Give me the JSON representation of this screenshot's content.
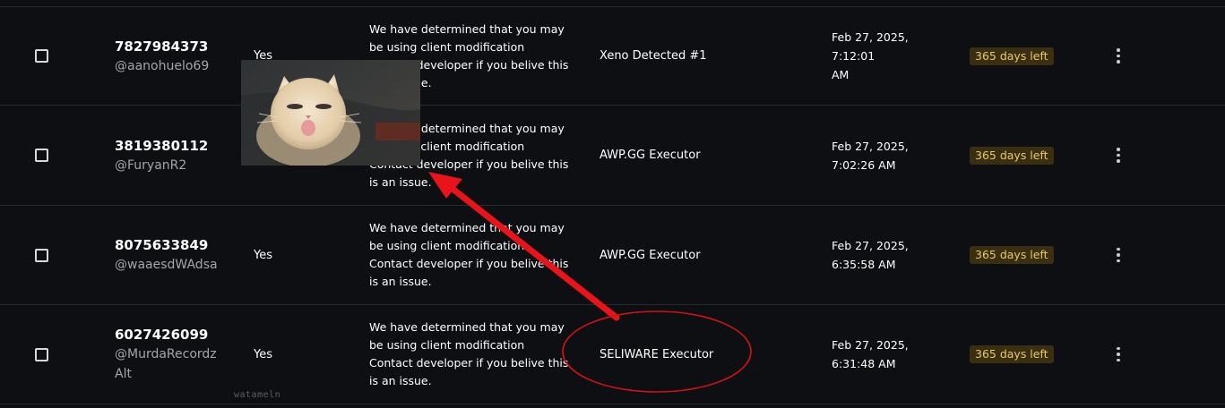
{
  "rows": [
    {
      "user_id": "7827984373",
      "handle": "@aanohuelo69",
      "banned": "Yes",
      "reason_lines": [
        "We have determined that you may",
        "be using client modification",
        "Contact developer if you belive this",
        "is an issue."
      ],
      "detection": "Xeno Detected #1",
      "date_line1": "Feb 27, 2025, 7:12:01",
      "date_line2": "AM",
      "remaining": "365 days left"
    },
    {
      "user_id": "3819380112",
      "handle": "@FuryanR2",
      "banned": "",
      "reason_lines": [
        "We have determined that you may",
        "be using client modification",
        "Contact developer if you belive this",
        "is an issue."
      ],
      "detection": "AWP.GG Executor",
      "date_line1": "Feb 27, 2025,",
      "date_line2": "7:02:26 AM",
      "remaining": "365 days left"
    },
    {
      "user_id": "8075633849",
      "handle": "@waaesdWAdsa",
      "banned": "Yes",
      "reason_lines": [
        "We have determined that you may",
        "be using client modification",
        "Contact developer if you belive this",
        "is an issue."
      ],
      "detection": "AWP.GG Executor",
      "date_line1": "Feb 27, 2025,",
      "date_line2": "6:35:58 AM",
      "remaining": "365 days left"
    },
    {
      "user_id": "6027426099",
      "handle": "@MurdaRecordz Alt",
      "banned": "Yes",
      "reason_lines": [
        "We have determined that you may",
        "be using client modification",
        "Contact developer if you belive this",
        "is an issue."
      ],
      "detection": "SELIWARE Executor",
      "date_line1": "Feb 27, 2025,",
      "date_line2": "6:31:48 AM",
      "remaining": "365 days left"
    }
  ],
  "watermark": "watameln",
  "colors": {
    "background": "#0e0f12",
    "divider": "#2a2b30",
    "badge_bg": "#3a2f10",
    "badge_text": "#e8c86a",
    "annotation_red": "#e8141a"
  },
  "icons": {
    "row_menu": "kebab-menu-icon",
    "row_select": "checkbox"
  }
}
